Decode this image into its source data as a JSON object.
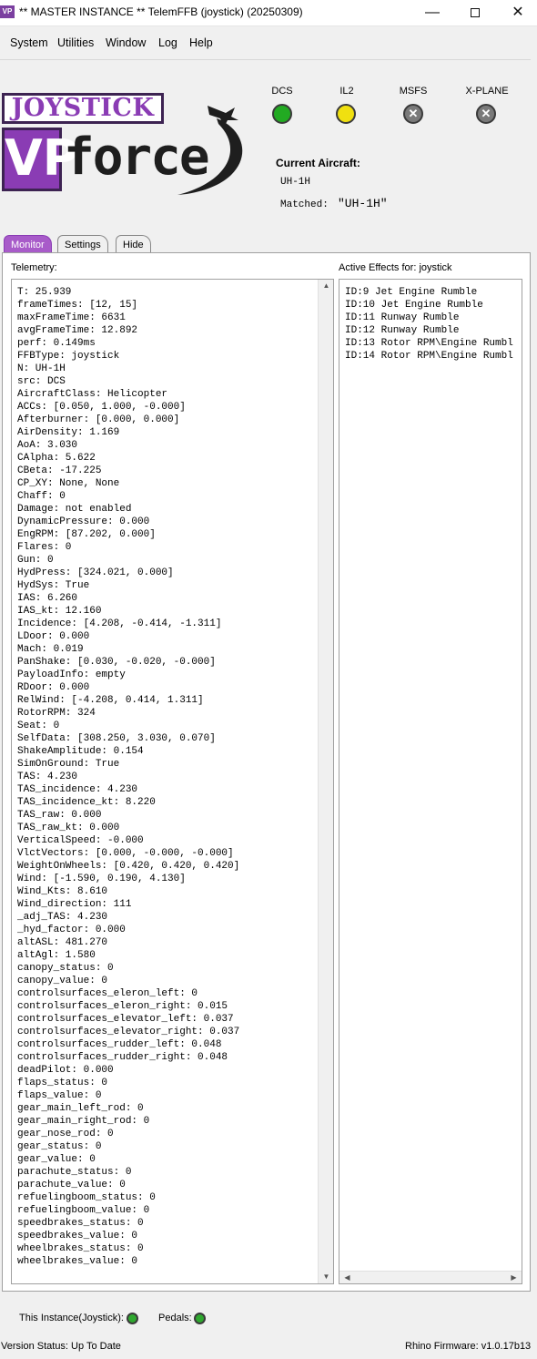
{
  "window": {
    "app_icon": "VP",
    "title": "** MASTER INSTANCE ** TelemFFB (joystick) (20250309)",
    "minimize_icon": "minimize-icon",
    "maximize_icon": "maximize-icon",
    "close_icon": "close-icon"
  },
  "menu": {
    "items": [
      "System",
      "Utilities",
      "Window",
      "Log",
      "Help"
    ]
  },
  "logo": {
    "top_text": "JOYSTICK",
    "mark_text": "VP",
    "word_text": "force"
  },
  "sims": [
    {
      "label": "DCS",
      "status": "active",
      "color": "#22aa22"
    },
    {
      "label": "IL2",
      "status": "idle",
      "color": "#f0e010"
    },
    {
      "label": "MSFS",
      "status": "disabled",
      "color": "#7a7a7a"
    },
    {
      "label": "X-PLANE",
      "status": "disabled",
      "color": "#7a7a7a"
    }
  ],
  "current_aircraft": {
    "label": "Current Aircraft:",
    "value": "UH-1H",
    "matched_label": "Matched:",
    "matched_value": "\"UH-1H\""
  },
  "tabs": [
    "Monitor",
    "Settings",
    "Hide"
  ],
  "monitor": {
    "telemetry_label": "Telemetry:",
    "effects_label": "Active Effects for: joystick",
    "telemetry": [
      "T: 25.939",
      "frameTimes: [12, 15]",
      "maxFrameTime: 6631",
      "avgFrameTime: 12.892",
      "perf: 0.149ms",
      "FFBType: joystick",
      "N: UH-1H",
      "src: DCS",
      "AircraftClass: Helicopter",
      "ACCs: [0.050, 1.000, -0.000]",
      "Afterburner: [0.000, 0.000]",
      "AirDensity: 1.169",
      "AoA: 3.030",
      "CAlpha: 5.622",
      "CBeta: -17.225",
      "CP_XY: None, None",
      "Chaff: 0",
      "Damage: not enabled",
      "DynamicPressure: 0.000",
      "EngRPM: [87.202, 0.000]",
      "Flares: 0",
      "Gun: 0",
      "HydPress: [324.021, 0.000]",
      "HydSys: True",
      "IAS: 6.260",
      "IAS_kt: 12.160",
      "Incidence: [4.208, -0.414, -1.311]",
      "LDoor: 0.000",
      "Mach: 0.019",
      "PanShake: [0.030, -0.020, -0.000]",
      "PayloadInfo: empty",
      "RDoor: 0.000",
      "RelWind: [-4.208, 0.414, 1.311]",
      "RotorRPM: 324",
      "Seat: 0",
      "SelfData: [308.250, 3.030, 0.070]",
      "ShakeAmplitude: 0.154",
      "SimOnGround: True",
      "TAS: 4.230",
      "TAS_incidence: 4.230",
      "TAS_incidence_kt: 8.220",
      "TAS_raw: 0.000",
      "TAS_raw_kt: 0.000",
      "VerticalSpeed: -0.000",
      "VlctVectors: [0.000, -0.000, -0.000]",
      "WeightOnWheels: [0.420, 0.420, 0.420]",
      "Wind: [-1.590, 0.190, 4.130]",
      "Wind_Kts: 8.610",
      "Wind_direction: 111",
      "_adj_TAS: 4.230",
      "_hyd_factor: 0.000",
      "altASL: 481.270",
      "altAgl: 1.580",
      "canopy_status: 0",
      "canopy_value: 0",
      "controlsurfaces_eleron_left: 0",
      "controlsurfaces_eleron_right: 0.015",
      "controlsurfaces_elevator_left: 0.037",
      "controlsurfaces_elevator_right: 0.037",
      "controlsurfaces_rudder_left: 0.048",
      "controlsurfaces_rudder_right: 0.048",
      "deadPilot: 0.000",
      "flaps_status: 0",
      "flaps_value: 0",
      "gear_main_left_rod: 0",
      "gear_main_right_rod: 0",
      "gear_nose_rod: 0",
      "gear_status: 0",
      "gear_value: 0",
      "parachute_status: 0",
      "parachute_value: 0",
      "refuelingboom_status: 0",
      "refuelingboom_value: 0",
      "speedbrakes_status: 0",
      "speedbrakes_value: 0",
      "wheelbrakes_status: 0",
      "wheelbrakes_value: 0"
    ],
    "effects": [
      "ID:9 Jet Engine Rumble",
      "ID:10 Jet Engine Rumble",
      "ID:11 Runway Rumble",
      "ID:12 Runway Rumble",
      "ID:13 Rotor RPM\\Engine Rumbl",
      "ID:14 Rotor RPM\\Engine Rumbl"
    ]
  },
  "footer": {
    "instance_label": "This Instance(Joystick):",
    "instance_led_color": "#2fa82f",
    "pedals_label": "Pedals:",
    "pedals_led_color": "#2fa82f",
    "version_status": "Version Status: Up To Date",
    "firmware": "Rhino Firmware: v1.0.17b13"
  }
}
